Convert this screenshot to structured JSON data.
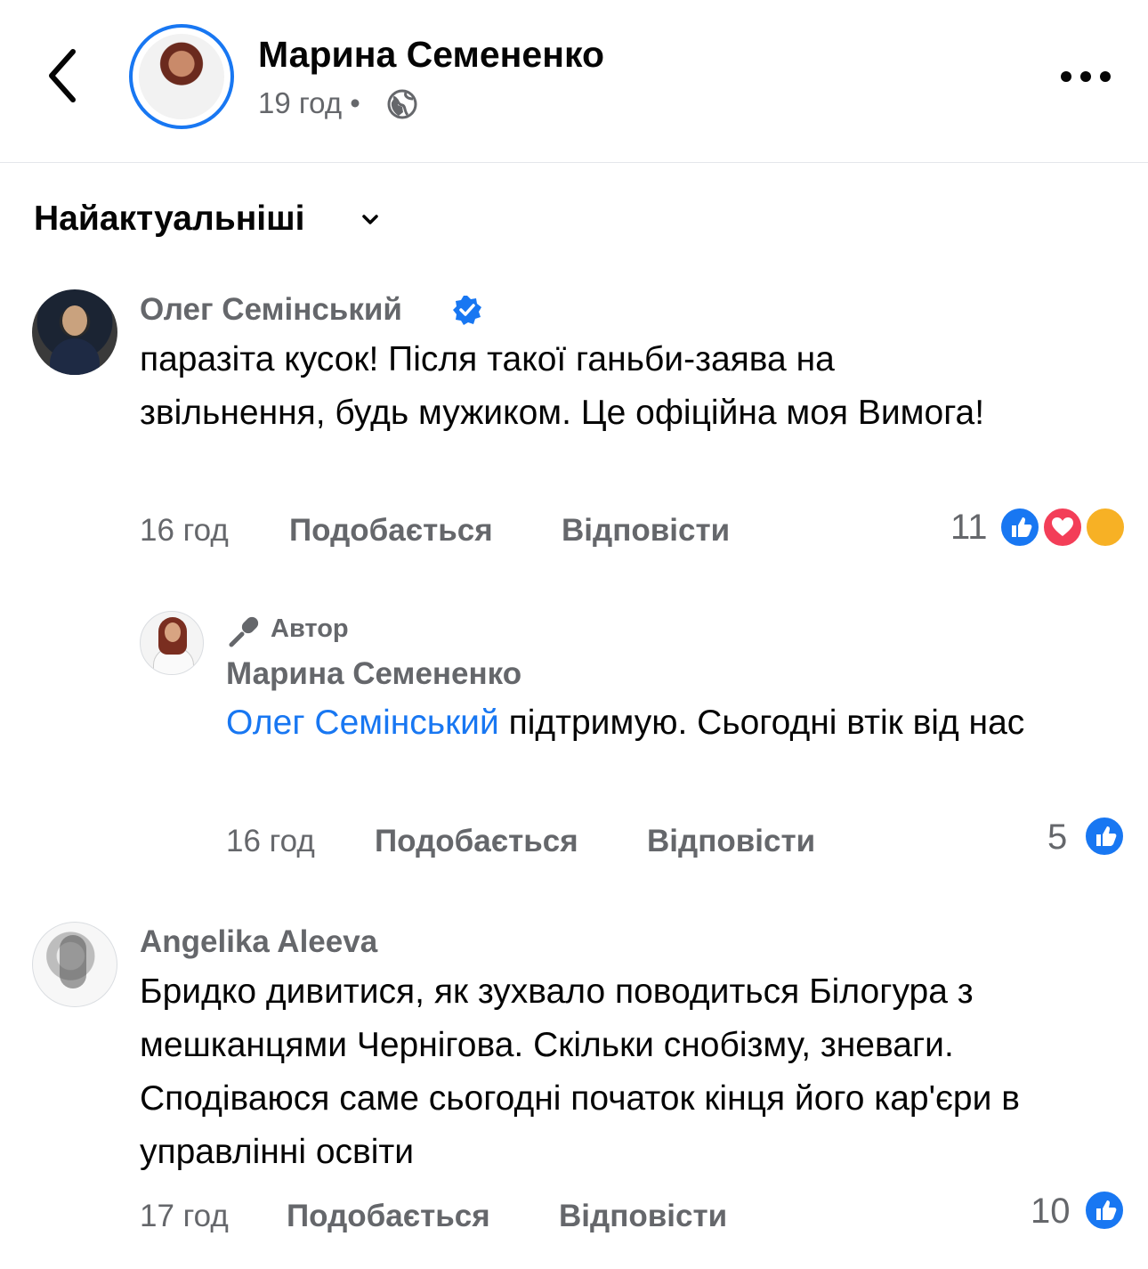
{
  "header": {
    "title": "Марина Семененко",
    "time": "19 год",
    "separator": "•",
    "icons": {
      "back": "chevron-left-icon",
      "privacy": "globe-icon",
      "more": "more-horizontal-icon"
    }
  },
  "sort": {
    "label": "Найактуальніші",
    "icon": "chevron-down-icon"
  },
  "comments": [
    {
      "author": "Олег Семінський",
      "verified": true,
      "text": "паразіта кусок! Після такої ганьби-заява на звільнення, будь мужиком. Це офіційна моя Вимога!",
      "time": "16 год",
      "like_label": "Подобається",
      "reply_label": "Відповісти",
      "reaction_count": "11",
      "reactions": [
        "like",
        "love",
        "care"
      ]
    },
    {
      "author_badge": "Автор",
      "author": "Марина Семененко",
      "mention": "Олег Семінський",
      "text": " підтримую. Сьогодні втік від нас",
      "time": "16 год",
      "like_label": "Подобається",
      "reply_label": "Відповісти",
      "reaction_count": "5",
      "reactions": [
        "like"
      ]
    },
    {
      "author": "Angelika Aleeva",
      "text": "Бридко дивитися, як зухвало поводиться Білогура з мешканцями Чернігова. Скільки снобізму, зневаги. Сподіваюся саме сьогодні початок кінця його кар'єри в управлінні освіти",
      "time": "17 год",
      "like_label": "Подобається",
      "reply_label": "Відповісти",
      "reaction_count": "10",
      "reactions": [
        "like"
      ]
    }
  ],
  "colors": {
    "accent": "#1877f2",
    "secondary_text": "#65676b",
    "love": "#f33e58",
    "care": "#f7b125"
  }
}
